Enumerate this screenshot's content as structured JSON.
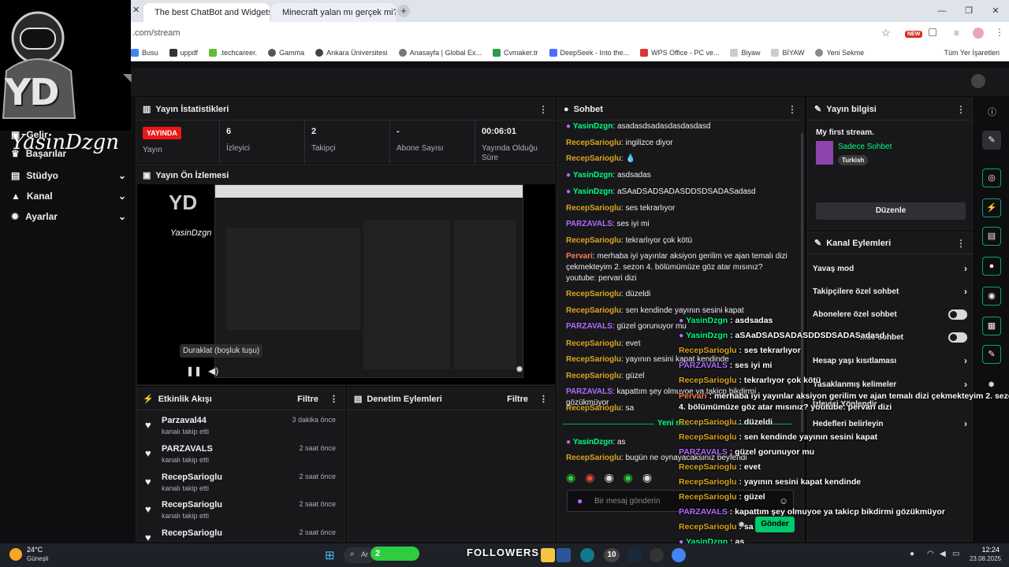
{
  "browser": {
    "tabs": [
      {
        "title": "The best ChatBot and Widgets"
      },
      {
        "title": "Minecraft yalan mı gerçek mi?"
      }
    ],
    "url": ".com/stream",
    "bookmarks": [
      "Busu",
      "uppdf",
      ".techcareer.",
      "Gamma",
      "Ankara Üniversitesi",
      "Anasayfa | Global Ex...",
      "Cvmaker.tr",
      "DeepSeek - Into the...",
      "WPS Office - PC ve...",
      "Biyaw",
      "BİYAW",
      "Yeni Sekme"
    ],
    "bookmarks_right": "Tüm Yer İşaretleri",
    "new_badge": "NEW"
  },
  "logo": {
    "initials": "YD",
    "name": "YasinDzgn"
  },
  "nav": {
    "items": [
      {
        "label": "Gelir"
      },
      {
        "label": "Başarılar"
      },
      {
        "label": "Stüdyo"
      },
      {
        "label": "Kanal"
      },
      {
        "label": "Ayarlar"
      }
    ]
  },
  "stats": {
    "title": "Yayın İstatistikleri",
    "live_badge": "YAYINDA",
    "live_label": "Yayın",
    "viewers_value": "6",
    "viewers_label": "İzleyici",
    "followers_value": "2",
    "followers_label": "Takipçi",
    "subs_value": "-",
    "subs_label": "Abone Sayısı",
    "uptime_value": "00:06:01",
    "uptime_label": "Yayında Olduğu Süre"
  },
  "preview": {
    "title": "Yayın Ön İzlemesi",
    "tooltip": "Duraklat (boşluk tuşu)"
  },
  "activity": {
    "title": "Etkinlik Akışı",
    "filter": "Filtre",
    "items": [
      {
        "name": "Parzaval44",
        "action": "kanalı takip etti",
        "time": "3 dakika önce"
      },
      {
        "name": "PARZAVALS",
        "action": "kanalı takip etti",
        "time": "2 saat önce"
      },
      {
        "name": "RecepSarioglu",
        "action": "kanalı takip etti",
        "time": "2 saat önce"
      },
      {
        "name": "RecepSarioglu",
        "action": "kanalı takip etti",
        "time": "2 saat önce"
      },
      {
        "name": "RecepSarioglu",
        "action": "",
        "time": "2 saat önce"
      }
    ]
  },
  "moderation": {
    "title": "Denetim Eylemleri",
    "filter": "Filtre"
  },
  "chat": {
    "title": "Sohbet",
    "new_messages": "Yeni m...",
    "input_placeholder": "Bir mesaj gönderin",
    "send_label": "Gönder",
    "messages": [
      {
        "user": "YasinDzgn",
        "text": "asadasdsadasdasdasdasd",
        "color": "#00ff7f"
      },
      {
        "user": "RecepSarioglu",
        "text": "ingilizce diyor",
        "color": "#daa520"
      },
      {
        "user": "RecepSarioglu",
        "text": "",
        "color": "#daa520"
      },
      {
        "user": "YasinDzgn",
        "text": "asdsadas",
        "color": "#00ff7f"
      },
      {
        "user": "YasinDzgn",
        "text": "aSAaDSADSADASDDSDSADASadasd",
        "color": "#00ff7f"
      },
      {
        "user": "RecepSarioglu",
        "text": "ses tekrarlıyor",
        "color": "#daa520"
      },
      {
        "user": "PARZAVALS",
        "text": "ses iyi mi",
        "color": "#b26bff"
      },
      {
        "user": "RecepSarioglu",
        "text": "tekrarlıyor çok kötü",
        "color": "#daa520"
      },
      {
        "user": "Pervari",
        "text": "merhaba iyi yayınlar aksiyon gerilim ve ajan temalı dizi çekmekteyim 2. sezon 4. bölümümüze göz atar mısınız? youtube: pervari dizi",
        "color": "#ff7f50"
      },
      {
        "user": "RecepSarioglu",
        "text": "düzeldi",
        "color": "#daa520"
      },
      {
        "user": "RecepSarioglu",
        "text": "sen kendinde yayının sesini kapat",
        "color": "#daa520"
      },
      {
        "user": "PARZAVALS",
        "text": "güzel gorunuyor mu",
        "color": "#b26bff"
      },
      {
        "user": "RecepSarioglu",
        "text": "evet",
        "color": "#daa520"
      },
      {
        "user": "RecepSarioglu",
        "text": "yayının sesini kapat kendinde",
        "color": "#daa520"
      },
      {
        "user": "RecepSarioglu",
        "text": "güzel",
        "color": "#daa520"
      },
      {
        "user": "PARZAVALS",
        "text": "kapattım şey olmuyoe ya takicp bikdirmi gözükmüyor",
        "color": "#b26bff"
      },
      {
        "user": "RecepSarioglu",
        "text": "sa",
        "color": "#daa520"
      },
      {
        "user": "YasinDzgn",
        "text": "as",
        "color": "#00ff7f"
      },
      {
        "user": "RecepSarioglu",
        "text": "bugün ne oynayacaksınız beyfendi",
        "color": "#daa520"
      }
    ]
  },
  "overlay": {
    "messages": [
      {
        "user": "YasinDzgn",
        "text": ": asdsadas"
      },
      {
        "user": "YasinDzgn",
        "text": ": aSAaDSADSADASDDSDSADASadasd"
      },
      {
        "user": "RecepSarioglu",
        "text": ": ses tekrarlıyor"
      },
      {
        "user": "PARZAVALS",
        "text": ": ses iyi mi"
      },
      {
        "user": "RecepSarioglu",
        "text": ": tekrarlıyor çok kötü"
      },
      {
        "user": "Pervari",
        "text": ": merhaba iyi yayınlar aksiyon gerilim ve ajan temalı dizi çekmekteyim 2. sezon"
      },
      {
        "user": "",
        "text": "4. bölümümüze göz atar mısınız? youtube: pervari dizi"
      },
      {
        "user": "RecepSarioglu",
        "text": ": düzeldi"
      },
      {
        "user": "RecepSarioglu",
        "text": ": sen kendinde yayının sesini kapat"
      },
      {
        "user": "PARZAVALS",
        "text": ": güzel gorunuyor mu"
      },
      {
        "user": "RecepSarioglu",
        "text": ": evet"
      },
      {
        "user": "RecepSarioglu",
        "text": ": yayının sesini kapat kendinde"
      },
      {
        "user": "RecepSarioglu",
        "text": ": güzel"
      },
      {
        "user": "PARZAVALS",
        "text": ": kapattım şey olmuyoe ya takicp bikdirmi gözükmüyor"
      },
      {
        "user": "RecepSarioglu",
        "text": ": sa"
      },
      {
        "user": "YasinDzgn",
        "text": ": as"
      },
      {
        "user": "RecepSarioglu",
        "text": ": bugün ne oynayacaksınız beyfendi"
      }
    ]
  },
  "stream_info": {
    "title": "Yayın bilgisi",
    "stream_title": "My first stream.",
    "category": "Sadece Sohbet",
    "tag": "Turkish",
    "edit_label": "Düzenle"
  },
  "channel_actions": {
    "title": "Kanal Eylemleri",
    "items": [
      {
        "label": "Yavaş mod",
        "control": "chevron"
      },
      {
        "label": "Takipçilere özel sohbet",
        "control": "chevron"
      },
      {
        "label": "Abonelere özel sohbet",
        "control": "toggle"
      },
      {
        "label": "...se sohbet",
        "control": "toggle"
      },
      {
        "label": "Hesap yaşı kısıtlaması",
        "control": "chevron"
      },
      {
        "label": "Yasaklanmış kelimeler",
        "control": "chevron"
      },
      {
        "label": "İzleyici Yönlendir",
        "control": "none"
      },
      {
        "label": "Hedefleri belirleyin",
        "control": "chevron"
      }
    ]
  },
  "taskbar": {
    "weather_temp": "24°C",
    "weather_desc": "Güneşli",
    "search_text": "Ar",
    "followers_text": "FOLLOWERS",
    "badge_green": "2",
    "badge_count": "10",
    "time": "12:24",
    "date": "23.08.2025"
  },
  "colors": {
    "accent_green": "#00a86b",
    "live_red": "#e91916",
    "panel_bg": "#18181b",
    "page_bg": "#0e0e10"
  }
}
